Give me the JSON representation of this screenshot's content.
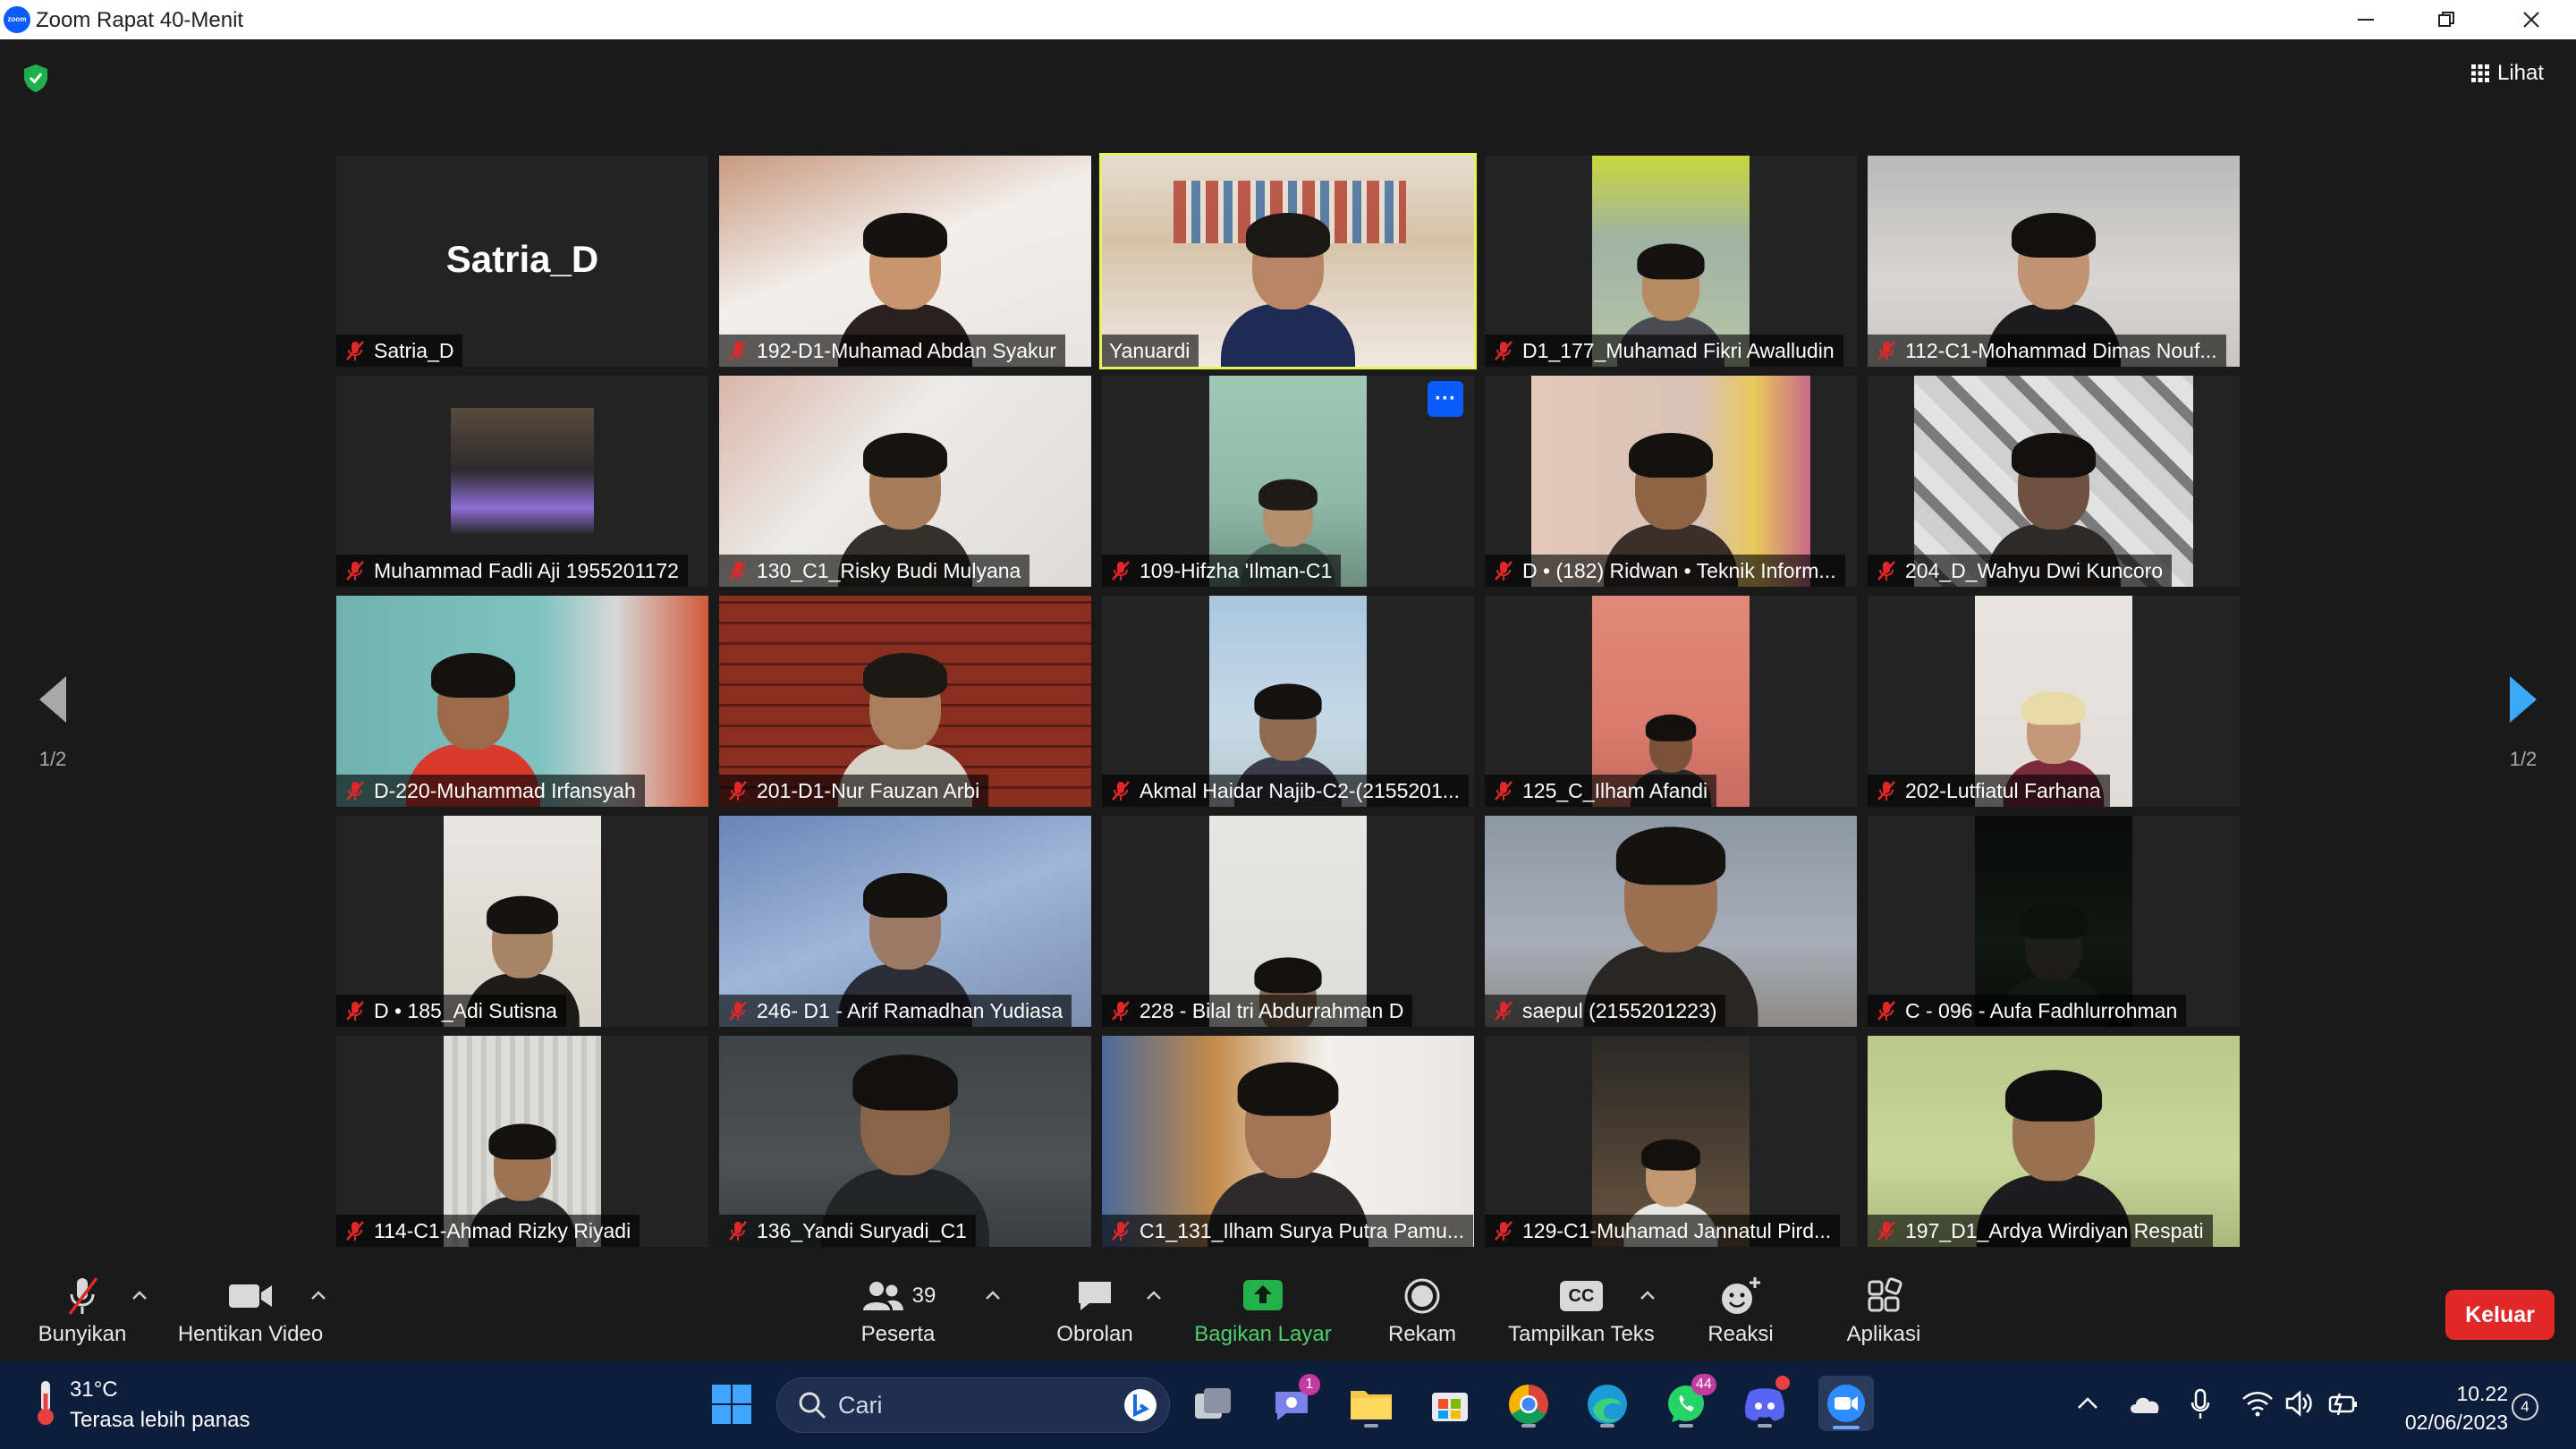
{
  "window": {
    "title": "Zoom Rapat 40-Menit",
    "logo_text": "zoom"
  },
  "meeting": {
    "view_label": "Lihat",
    "page_left": "1/2",
    "page_right": "1/2",
    "tiles": [
      {
        "name": "Satria_D",
        "big_label": "Satria_D",
        "muted": true
      },
      {
        "name": "192-D1-Muhamad Abdan Syakur",
        "muted": true
      },
      {
        "name": "Yanuardi",
        "muted": false,
        "active": true
      },
      {
        "name": "D1_177_Muhamad Fikri Awalludin",
        "muted": true
      },
      {
        "name": "112-C1-Mohammad Dimas Nouf...",
        "muted": true
      },
      {
        "name": "Muhammad Fadli Aji 1955201172",
        "muted": true
      },
      {
        "name": "130_C1_Risky Budi Mulyana",
        "muted": true
      },
      {
        "name": "109-Hifzha 'Ilman-C1",
        "muted": true,
        "more": "···"
      },
      {
        "name": "D • (182) Ridwan • Teknik Inform...",
        "muted": true
      },
      {
        "name": "204_D_Wahyu Dwi Kuncoro",
        "muted": true
      },
      {
        "name": "D-220-Muhammad Irfansyah",
        "muted": true
      },
      {
        "name": "201-D1-Nur Fauzan Arbi",
        "muted": true
      },
      {
        "name": "Akmal Haidar Najib-C2-(2155201...",
        "muted": true
      },
      {
        "name": "125_C_Ilham Afandi",
        "muted": true
      },
      {
        "name": "202-Lutfiatul Farhana",
        "muted": true
      },
      {
        "name": "D • 185_Adi Sutisna",
        "muted": true
      },
      {
        "name": "246- D1 - Arif Ramadhan Yudiasa",
        "muted": true
      },
      {
        "name": "228 - Bilal tri Abdurrahman D",
        "muted": true
      },
      {
        "name": "saepul (2155201223)",
        "muted": true
      },
      {
        "name": "C - 096 - Aufa Fadhlurrohman",
        "muted": true
      },
      {
        "name": "114-C1-Ahmad Rizky Riyadi",
        "muted": true
      },
      {
        "name": "136_Yandi Suryadi_C1",
        "muted": true
      },
      {
        "name": "C1_131_Ilham Surya Putra Pamu...",
        "muted": true
      },
      {
        "name": "129-C1-Muhamad Jannatul Pird...",
        "muted": true
      },
      {
        "name": "197_D1_Ardya Wirdiyan Respati",
        "muted": true
      }
    ]
  },
  "toolbar": {
    "unmute": "Bunyikan",
    "stop_video": "Hentikan Video",
    "participants": "Peserta",
    "participants_count": "39",
    "chat": "Obrolan",
    "share": "Bagikan Layar",
    "record": "Rekam",
    "captions": "Tampilkan Teks",
    "captions_icon_text": "CC",
    "reactions": "Reaksi",
    "apps": "Aplikasi",
    "leave": "Keluar"
  },
  "taskbar": {
    "temperature": "31°C",
    "weather_text": "Terasa lebih panas",
    "search_placeholder": "Cari",
    "teams_badge": "1",
    "whatsapp_badge": "44",
    "time": "10.22",
    "date": "02/06/2023",
    "notifications": "4"
  },
  "colors": {
    "active_speaker": "#e8f356",
    "leave": "#e02828",
    "share": "#22b24c",
    "taskbar": "#0d1d3c"
  }
}
